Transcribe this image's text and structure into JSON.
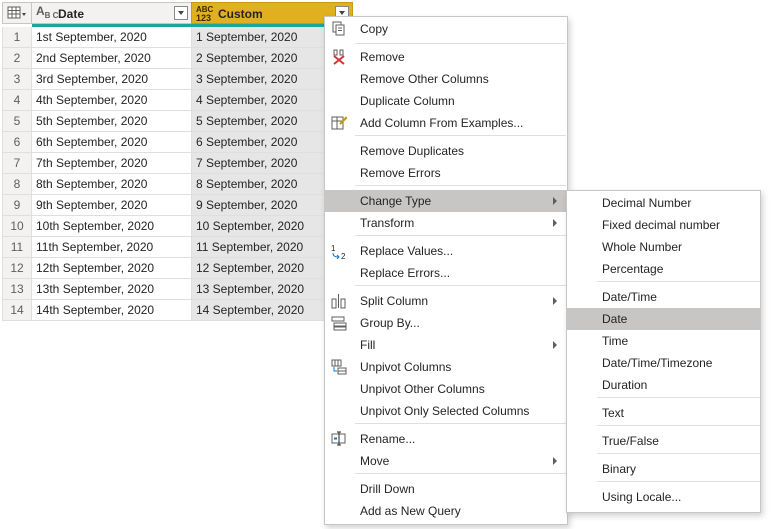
{
  "grid": {
    "columns": [
      {
        "type_top": "A",
        "type_bottom": "B C",
        "name": "Date"
      },
      {
        "type_top": "ABC",
        "type_bottom": "123",
        "name": "Custom"
      }
    ],
    "rows": [
      {
        "idx": "1",
        "date": "1st September, 2020",
        "custom": "1 September, 2020"
      },
      {
        "idx": "2",
        "date": "2nd September, 2020",
        "custom": "2 September, 2020"
      },
      {
        "idx": "3",
        "date": "3rd September, 2020",
        "custom": "3 September, 2020"
      },
      {
        "idx": "4",
        "date": "4th September, 2020",
        "custom": "4 September, 2020"
      },
      {
        "idx": "5",
        "date": "5th September, 2020",
        "custom": "5 September, 2020"
      },
      {
        "idx": "6",
        "date": "6th September, 2020",
        "custom": "6 September, 2020"
      },
      {
        "idx": "7",
        "date": "7th September, 2020",
        "custom": "7 September, 2020"
      },
      {
        "idx": "8",
        "date": "8th September, 2020",
        "custom": "8 September, 2020"
      },
      {
        "idx": "9",
        "date": "9th September, 2020",
        "custom": "9 September, 2020"
      },
      {
        "idx": "10",
        "date": "10th September, 2020",
        "custom": "10 September, 2020"
      },
      {
        "idx": "11",
        "date": "11th September, 2020",
        "custom": "11 September, 2020"
      },
      {
        "idx": "12",
        "date": "12th September, 2020",
        "custom": "12 September, 2020"
      },
      {
        "idx": "13",
        "date": "13th September, 2020",
        "custom": "13 September, 2020"
      },
      {
        "idx": "14",
        "date": "14th September, 2020",
        "custom": "14 September, 2020"
      }
    ]
  },
  "context_menu": {
    "items": [
      {
        "label": "Copy",
        "icon": "copy-icon"
      },
      {
        "label": "Remove",
        "icon": "remove-icon"
      },
      {
        "label": "Remove Other Columns"
      },
      {
        "label": "Duplicate Column"
      },
      {
        "label": "Add Column From Examples...",
        "icon": "examples-icon"
      },
      {
        "label": "Remove Duplicates"
      },
      {
        "label": "Remove Errors"
      },
      {
        "label": "Change Type",
        "submenu": true,
        "highlighted": true
      },
      {
        "label": "Transform",
        "submenu": true
      },
      {
        "label": "Replace Values...",
        "icon": "replace-values-icon"
      },
      {
        "label": "Replace Errors..."
      },
      {
        "label": "Split Column",
        "submenu": true,
        "icon": "split-column-icon"
      },
      {
        "label": "Group By...",
        "icon": "group-by-icon"
      },
      {
        "label": "Fill",
        "submenu": true
      },
      {
        "label": "Unpivot Columns",
        "icon": "unpivot-icon"
      },
      {
        "label": "Unpivot Other Columns"
      },
      {
        "label": "Unpivot Only Selected Columns"
      },
      {
        "label": "Rename...",
        "icon": "rename-icon"
      },
      {
        "label": "Move",
        "submenu": true
      },
      {
        "label": "Drill Down"
      },
      {
        "label": "Add as New Query"
      }
    ]
  },
  "change_type_menu": {
    "items": [
      {
        "label": "Decimal Number"
      },
      {
        "label": "Fixed decimal number"
      },
      {
        "label": "Whole Number"
      },
      {
        "label": "Percentage"
      },
      {
        "label": "Date/Time"
      },
      {
        "label": "Date",
        "highlighted": true
      },
      {
        "label": "Time"
      },
      {
        "label": "Date/Time/Timezone"
      },
      {
        "label": "Duration"
      },
      {
        "label": "Text"
      },
      {
        "label": "True/False"
      },
      {
        "label": "Binary"
      },
      {
        "label": "Using Locale..."
      }
    ]
  },
  "colors": {
    "accent_header": "#e0b020",
    "quality_bar": "#16a89b",
    "menu_highlight": "#c8c6c4",
    "remove_icon": "#d13438"
  }
}
